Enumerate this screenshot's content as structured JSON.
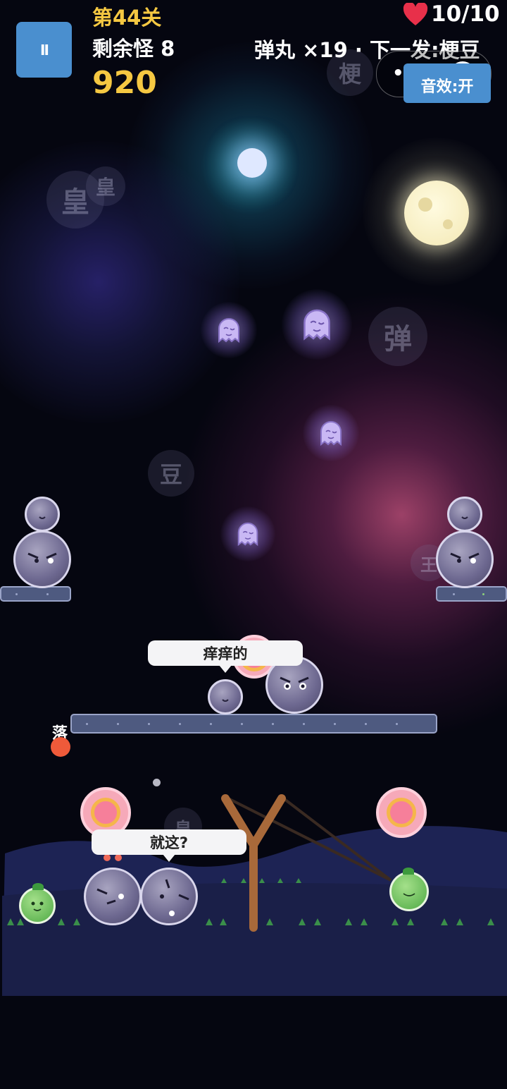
{
  "hud": {
    "level": "第44关",
    "remaining": "剩余怪 8",
    "score": "920",
    "lives": "10/10",
    "ammo": "弹丸 ×19 · 下一发:梗豆",
    "sound": "音效:开",
    "pause_symbol": "II",
    "heart_icon": "heart-icon",
    "colors": {
      "level": "#f5c842",
      "score": "#f5c842",
      "button": "#4a8fcf",
      "heart": "#e8304a"
    }
  },
  "floating_chars": [
    "皇",
    "皇",
    "梗",
    "弹",
    "豆",
    "王",
    "皇"
  ],
  "drop_label": "落",
  "speech": {
    "top": "痒痒的",
    "bottom": "就这?"
  }
}
